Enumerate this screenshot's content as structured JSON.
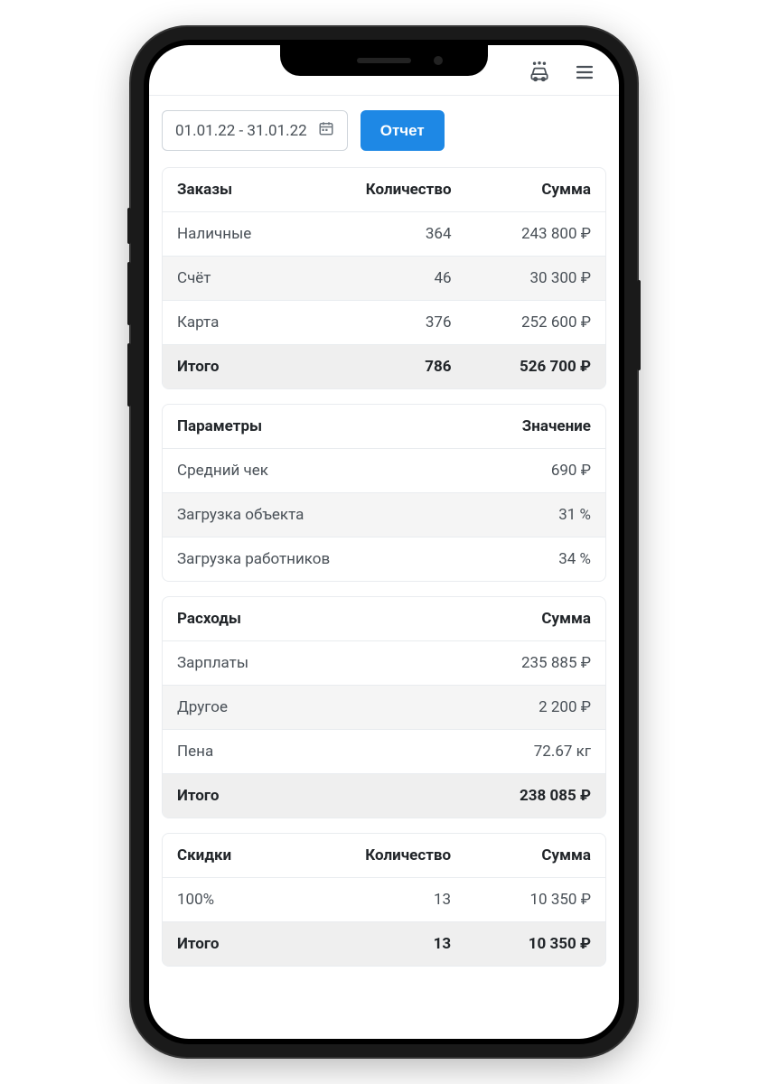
{
  "topbar": {
    "logo_icon": "carwash-icon",
    "menu_icon": "hamburger-icon"
  },
  "controls": {
    "date_range": "01.01.22 - 31.01.22",
    "calendar_icon": "calendar-icon",
    "report_button": "Отчет"
  },
  "orders_table": {
    "headers": {
      "col1": "Заказы",
      "col2": "Количество",
      "col3": "Сумма"
    },
    "rows": [
      {
        "name": "Наличные",
        "qty": "364",
        "sum": "243 800 ₽"
      },
      {
        "name": "Счёт",
        "qty": "46",
        "sum": "30 300 ₽"
      },
      {
        "name": "Карта",
        "qty": "376",
        "sum": "252 600 ₽"
      }
    ],
    "total": {
      "name": "Итого",
      "qty": "786",
      "sum": "526 700 ₽"
    }
  },
  "params_table": {
    "headers": {
      "col1": "Параметры",
      "col2": "Значение"
    },
    "rows": [
      {
        "name": "Средний чек",
        "value": "690 ₽"
      },
      {
        "name": "Загрузка объекта",
        "value": "31 %"
      },
      {
        "name": "Загрузка работников",
        "value": "34 %"
      }
    ]
  },
  "expenses_table": {
    "headers": {
      "col1": "Расходы",
      "col2": "Сумма"
    },
    "rows": [
      {
        "name": "Зарплаты",
        "value": "235 885 ₽"
      },
      {
        "name": "Другое",
        "value": "2 200 ₽"
      },
      {
        "name": "Пена",
        "value": "72.67 кг"
      }
    ],
    "total": {
      "name": "Итого",
      "value": "238 085 ₽"
    }
  },
  "discounts_table": {
    "headers": {
      "col1": "Скидки",
      "col2": "Количество",
      "col3": "Сумма"
    },
    "rows": [
      {
        "name": "100%",
        "qty": "13",
        "sum": "10 350 ₽"
      }
    ],
    "total": {
      "name": "Итого",
      "qty": "13",
      "sum": "10 350 ₽"
    }
  }
}
